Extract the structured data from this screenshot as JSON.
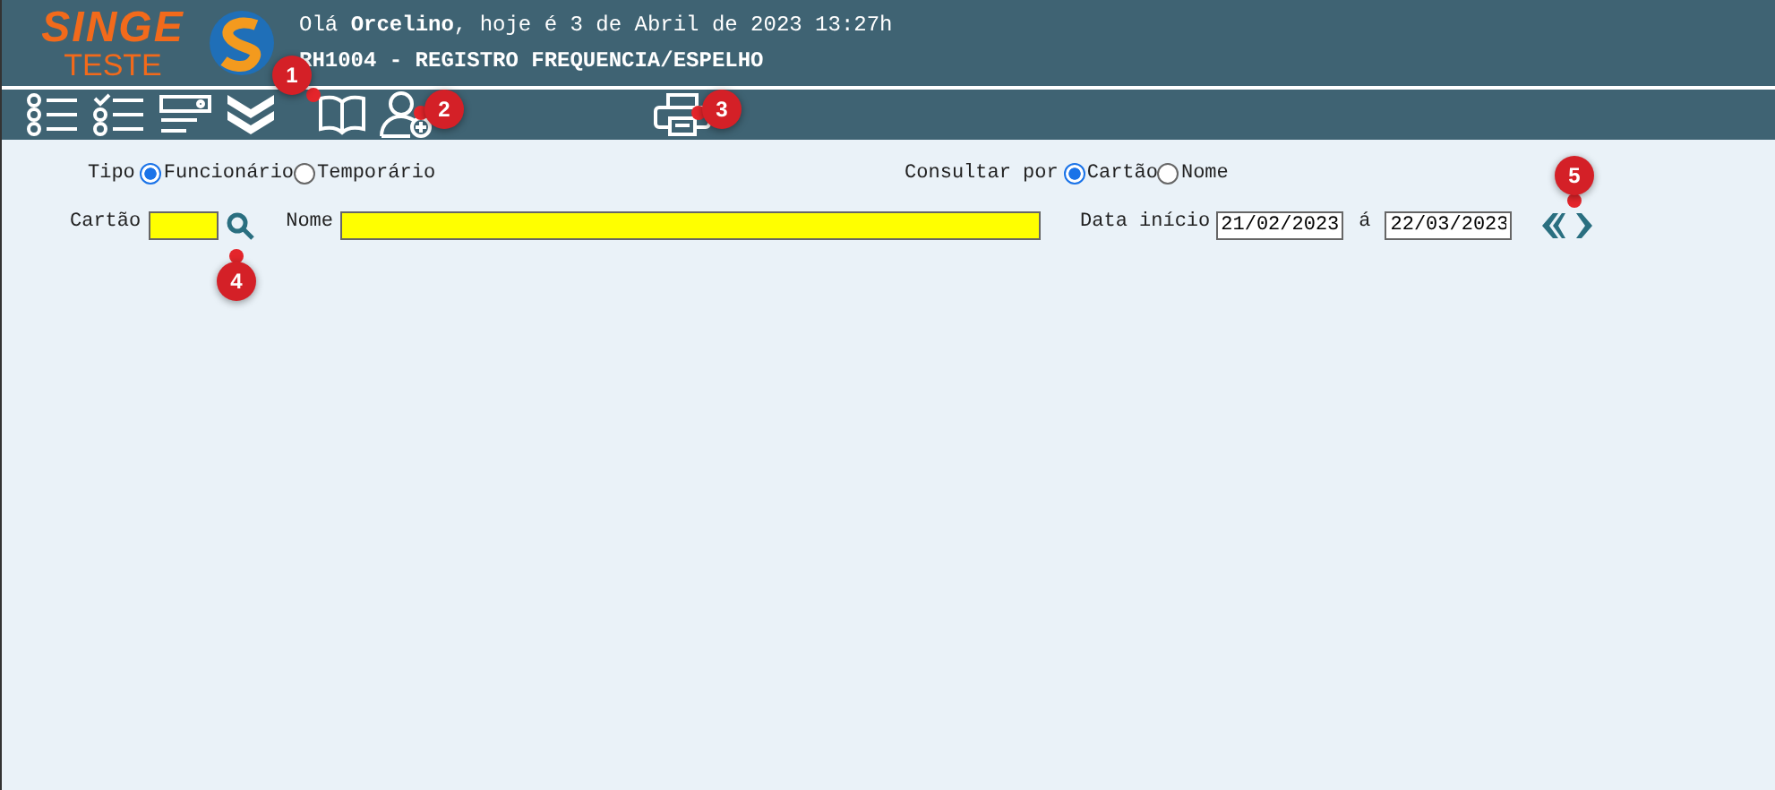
{
  "header": {
    "logo_top": "SINGE",
    "logo_bottom": "TESTE",
    "greeting": "Olá **Orcelino**, hoje é 3 de Abril de 2023 13:27h",
    "title": "RH1004 - REGISTRO FREQUENCIA/ESPELHO"
  },
  "form": {
    "tipo_label": "Tipo",
    "tipo_options": [
      {
        "label": "Funcionário",
        "selected": true
      },
      {
        "label": "Temporário",
        "selected": false
      }
    ],
    "consultar_label": "Consultar por",
    "consultar_options": [
      {
        "label": "Cartão",
        "selected": true
      },
      {
        "label": "Nome",
        "selected": false
      }
    ],
    "cartao_label": "Cartão",
    "nome_label": "Nome",
    "data_label": "Data início",
    "data_inicio": "21/02/2023",
    "separator": "á",
    "data_fim": "22/03/2023"
  },
  "markers": [
    "1",
    "2",
    "3",
    "4",
    "5"
  ]
}
